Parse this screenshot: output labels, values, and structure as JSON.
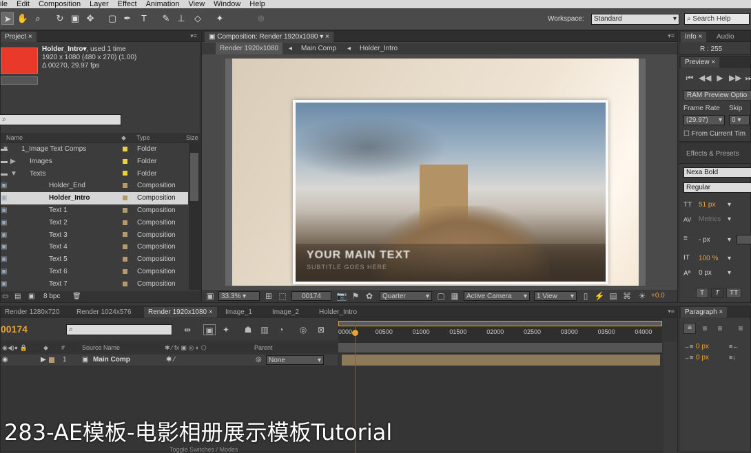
{
  "menu": [
    "ile",
    "Edit",
    "Composition",
    "Layer",
    "Effect",
    "Animation",
    "View",
    "Window",
    "Help"
  ],
  "toolbar": {
    "workspace_label": "Workspace:",
    "workspace_value": "Standard",
    "search_placeholder": "Search Help"
  },
  "project": {
    "tab": "Project",
    "item_name": "Holder_Intro▾",
    "item_used": ", used 1 time",
    "item_dims": "1920 x 1080  (480 x 270) (1.00)",
    "item_duration": "Δ 00270, 29.97 fps",
    "col_name": "Name",
    "col_type": "Type",
    "col_size": "Size",
    "bpc": "8 bpc",
    "colors": {
      "folder": "#e8d23a",
      "comp": "#b39b6e",
      "thumb": "#e8392a"
    },
    "items": [
      {
        "name": "1_Image Text Comps",
        "type": "Folder",
        "kind": "folder",
        "indent": 0,
        "arrow": "▼"
      },
      {
        "name": "Images",
        "type": "Folder",
        "kind": "folder",
        "indent": 1,
        "arrow": "▶"
      },
      {
        "name": "Texts",
        "type": "Folder",
        "kind": "folder",
        "indent": 1,
        "arrow": "▼"
      },
      {
        "name": "Holder_End",
        "type": "Composition",
        "kind": "comp",
        "indent": 2,
        "arrow": ""
      },
      {
        "name": "Holder_Intro",
        "type": "Composition",
        "kind": "comp",
        "indent": 2,
        "arrow": "",
        "selected": true
      },
      {
        "name": "Text 1",
        "type": "Composition",
        "kind": "comp",
        "indent": 2,
        "arrow": ""
      },
      {
        "name": "Text 2",
        "type": "Composition",
        "kind": "comp",
        "indent": 2,
        "arrow": ""
      },
      {
        "name": "Text 3",
        "type": "Composition",
        "kind": "comp",
        "indent": 2,
        "arrow": ""
      },
      {
        "name": "Text 4",
        "type": "Composition",
        "kind": "comp",
        "indent": 2,
        "arrow": ""
      },
      {
        "name": "Text 5",
        "type": "Composition",
        "kind": "comp",
        "indent": 2,
        "arrow": ""
      },
      {
        "name": "Text 6",
        "type": "Composition",
        "kind": "comp",
        "indent": 2,
        "arrow": ""
      },
      {
        "name": "Text 7",
        "type": "Composition",
        "kind": "comp",
        "indent": 2,
        "arrow": ""
      }
    ]
  },
  "composition": {
    "tab": "Composition: Render 1920x1080",
    "breadcrumbs": [
      "Render 1920x1080",
      "Main Comp",
      "Holder_Intro"
    ],
    "preview_text_main": "YOUR MAIN TEXT",
    "preview_text_sub": "SUBTITLE GOES HERE",
    "zoom": "33.3%",
    "timecode": "00174",
    "resolution": "Quarter",
    "camera": "Active Camera",
    "view": "1 View",
    "exposure": "+0.0"
  },
  "info": {
    "tabs": [
      "Info",
      "Audio"
    ],
    "readout": "R : 255"
  },
  "preview": {
    "tab": "Preview",
    "ram_button": "RAM Preview Optio",
    "frame_rate_label": "Frame Rate",
    "skip_label": "Skip",
    "frame_rate_value": "(29.97)",
    "skip_value": "0",
    "from_current": "From Current Tim"
  },
  "effects": {
    "tab": "Effects & Presets",
    "font": "Nexa Bold",
    "style": "Regular",
    "size": "51 px",
    "tracking": "Metrics",
    "leading": "- px",
    "vscale": "100 %",
    "baseline": "0 px"
  },
  "paragraph": {
    "tab": "Paragraph",
    "indent1": "0 px",
    "indent2": "0 px"
  },
  "timeline": {
    "tabs": [
      "Render 1280x720",
      "Render 1024x576",
      "Render 1920x1080",
      "Image_1",
      "Image_2",
      "Holder_Intro"
    ],
    "active_tab": 2,
    "timecode": "00174",
    "col_source": "Source Name",
    "col_parent": "Parent",
    "layer_num": "1",
    "layer_name": "Main Comp",
    "parent_value": "None",
    "ruler": [
      "0000",
      "00500",
      "01000",
      "01500",
      "02000",
      "02500",
      "03000",
      "03500",
      "04000"
    ],
    "bottom_label": "Toggle Switches / Modes"
  },
  "subtitle": "283-AE模板-电影相册展示模板Tutorial"
}
